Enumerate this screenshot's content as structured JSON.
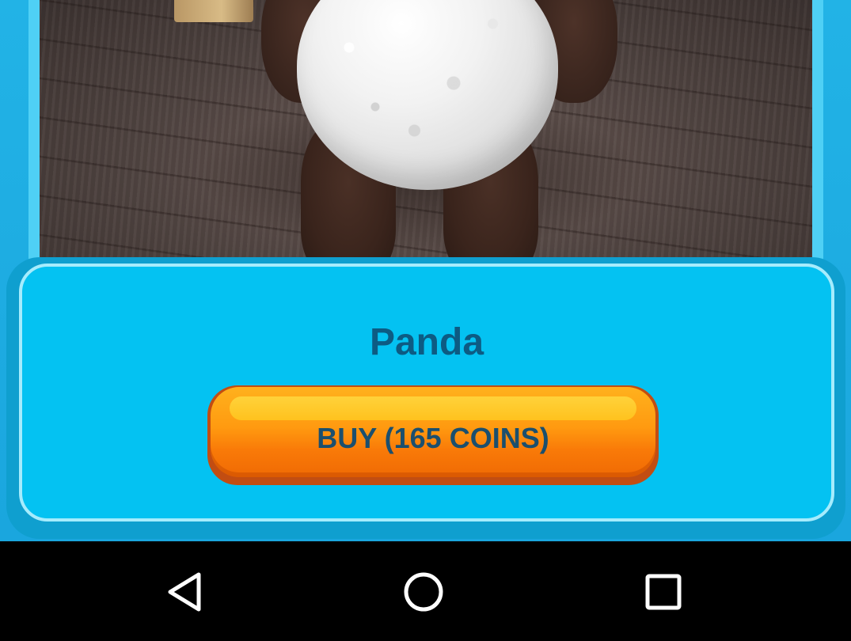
{
  "item": {
    "name": "Panda",
    "buy_label": "BUY (165 COINS)"
  },
  "colors": {
    "background": "#1aa6de",
    "card": "#04c2f2",
    "title": "#0d5b83",
    "button": "#ff9a10",
    "button_text": "#1b4f6e",
    "nav_bar": "#000000"
  },
  "nav_bar": {
    "buttons": [
      {
        "icon": "back-triangle-icon"
      },
      {
        "icon": "home-circle-icon"
      },
      {
        "icon": "recents-square-icon"
      }
    ]
  }
}
